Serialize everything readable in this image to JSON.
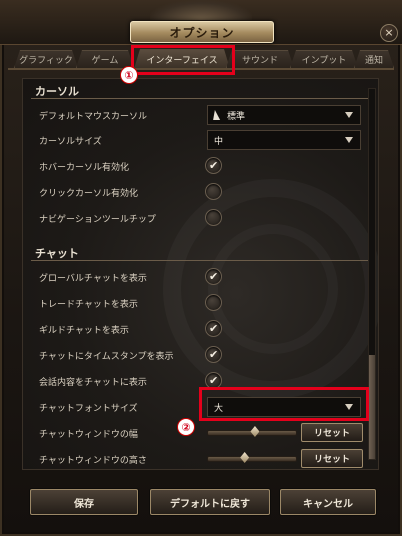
{
  "window": {
    "title": "オプション",
    "close_symbol": "×"
  },
  "tabs": [
    {
      "label": "グラフィック",
      "active": false
    },
    {
      "label": "ゲーム",
      "active": false
    },
    {
      "label": "インターフェイス",
      "active": true
    },
    {
      "label": "サウンド",
      "active": false
    },
    {
      "label": "インプット",
      "active": false
    },
    {
      "label": "通知",
      "active": false
    }
  ],
  "sections": {
    "cursor": "カーソル",
    "chat": "チャット"
  },
  "cursor_settings": {
    "default_mouse_cursor": {
      "label": "デフォルトマウスカーソル",
      "value": "標準"
    },
    "cursor_size": {
      "label": "カーソルサイズ",
      "value": "中"
    },
    "hover_cursor": {
      "label": "ホバーカーソル有効化",
      "checked": true
    },
    "click_cursor": {
      "label": "クリックカーソル有効化",
      "checked": false
    },
    "nav_tooltip": {
      "label": "ナビゲーションツールチップ",
      "checked": false
    }
  },
  "chat_settings": {
    "global_chat": {
      "label": "グローバルチャットを表示",
      "checked": true
    },
    "trade_chat": {
      "label": "トレードチャットを表示",
      "checked": false
    },
    "guild_chat": {
      "label": "ギルドチャットを表示",
      "checked": true
    },
    "timestamp": {
      "label": "チャットにタイムスタンプを表示",
      "checked": true
    },
    "conversation": {
      "label": "会話内容をチャットに表示",
      "checked": true
    },
    "font_size": {
      "label": "チャットフォントサイズ",
      "value": "大"
    },
    "window_width": {
      "label": "チャットウィンドウの幅",
      "level": 0.55,
      "reset": "リセット"
    },
    "window_height": {
      "label": "チャットウィンドウの高さ",
      "level": 0.42,
      "reset": "リセット"
    }
  },
  "footer": {
    "save": "保存",
    "default": "デフォルトに戻す",
    "cancel": "キャンセル"
  },
  "annotations": {
    "marker1": "①",
    "marker2": "②",
    "color": "#e4001b"
  },
  "checkmark_symbol": "✔"
}
